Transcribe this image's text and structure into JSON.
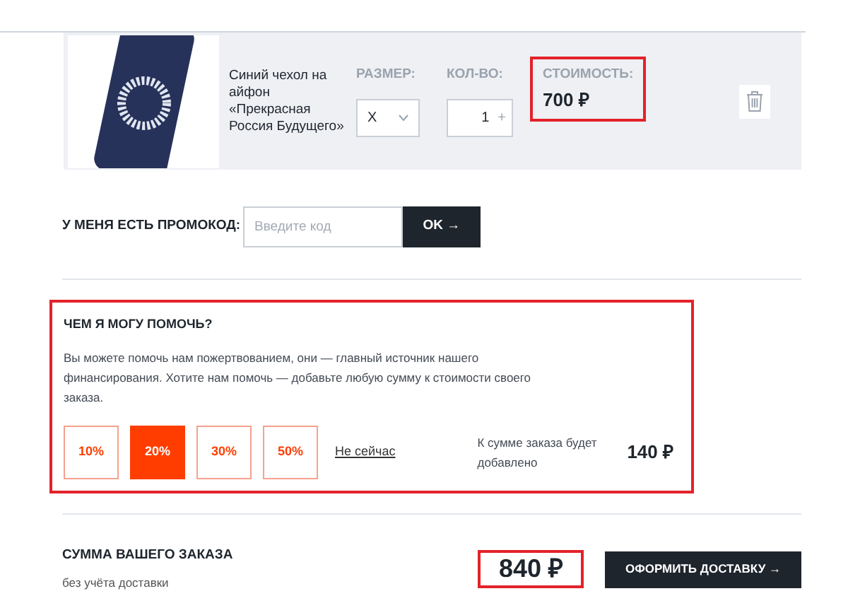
{
  "cart_item": {
    "name": "Синий чехол на айфон «Прекрасная Россия Будущего»",
    "size_label": "РАЗМЕР:",
    "size_value": "X",
    "qty_label": "КОЛ-ВО:",
    "qty_value": "1",
    "qty_plus": "+",
    "price_label": "СТОИМОСТЬ:",
    "price": "700 ₽",
    "price_highlighted": true
  },
  "promo": {
    "label": "У МЕНЯ ЕСТЬ ПРОМОКОД:",
    "placeholder": "Введите код",
    "button": "OK →"
  },
  "donation": {
    "highlighted": true,
    "title": "ЧЕМ Я МОГУ ПОМОЧЬ?",
    "text": "Вы можете помочь нам пожертвованием, они — главный источник нашего финансирования. Хотите нам помочь — добавьте любую сумму к стоимости своего заказа.",
    "options": [
      {
        "label": "10%",
        "selected": false
      },
      {
        "label": "20%",
        "selected": true
      },
      {
        "label": "30%",
        "selected": false
      },
      {
        "label": "50%",
        "selected": false
      }
    ],
    "skip_link": "Не сейчас",
    "added_label": "К сумме заказа будет добавлено",
    "added_amount": "140 ₽"
  },
  "summary": {
    "title": "СУММА ВАШЕГО ЗАКАЗА",
    "subtitle": "без учёта доставки",
    "total": "840 ₽",
    "total_highlighted": true,
    "button": "ОФОРМИТЬ ДОСТАВКУ →"
  }
}
